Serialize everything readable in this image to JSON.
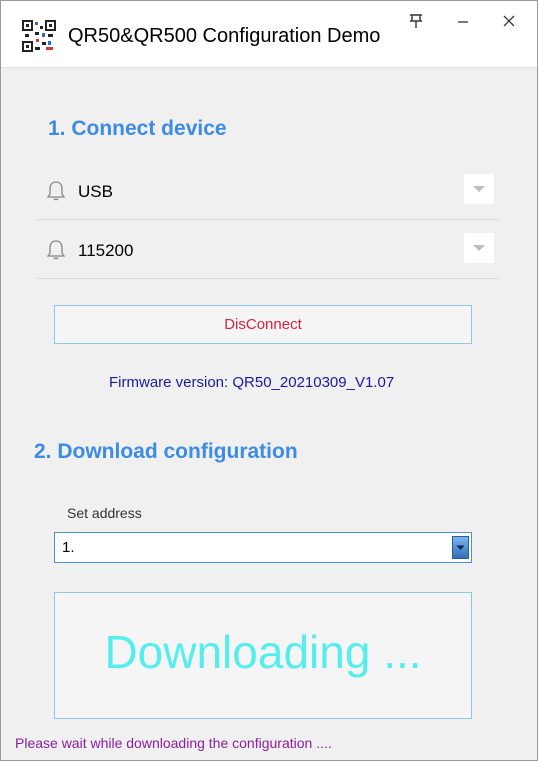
{
  "window": {
    "title": "QR50&QR500 Configuration Demo",
    "icons": {
      "app": "qr-code-icon",
      "pin": "pin-icon",
      "minimize": "minimize-icon",
      "close": "close-icon"
    }
  },
  "connect": {
    "heading": "1. Connect device",
    "port": {
      "value": "USB",
      "icon": "bell-icon",
      "dropdown_icon": "chevron-down-icon"
    },
    "baud": {
      "value": "115200",
      "icon": "bell-icon",
      "dropdown_icon": "chevron-down-icon"
    },
    "disconnect_label": "DisConnect",
    "firmware_version": "Firmware version: QR50_20210309_V1.07"
  },
  "download": {
    "heading": "2. Download configuration",
    "address_label": "Set address",
    "address_value": "1.",
    "progress_text": "Downloading ..."
  },
  "status_text": "Please wait while downloading the configuration ....",
  "colors": {
    "accent": "#3c8be6",
    "disconnect_text": "#d6233b",
    "firmware_text": "#1a1aa3",
    "downloading_text": "#55eeee",
    "status_text": "#8a1fa0"
  }
}
